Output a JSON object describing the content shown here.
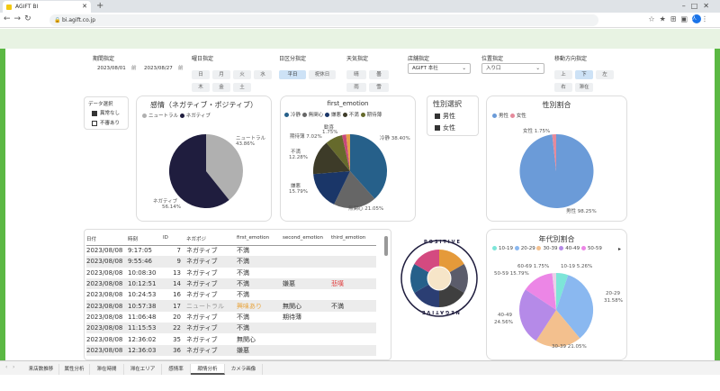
{
  "browser": {
    "tab_title": "AGIFT BI",
    "url": "bi.agift.co.jp"
  },
  "filters": {
    "period": {
      "label": "期間指定",
      "from": "2023/08/01",
      "sep": "前",
      "to": "2023/08/27",
      "sep2": "前"
    },
    "weekday": {
      "label": "曜日指定",
      "items": [
        "日",
        "月",
        "火",
        "水",
        "木",
        "金",
        "土"
      ]
    },
    "daytype": {
      "label": "日区分指定",
      "items": [
        "平日",
        "祝休日"
      ],
      "selected": "平日"
    },
    "weather": {
      "label": "天気指定",
      "items": [
        "晴",
        "曇",
        "雨",
        "雪"
      ]
    },
    "store": {
      "label": "店舗指定",
      "value": "AGIFT 本社"
    },
    "position": {
      "label": "位置指定",
      "value": "入り口"
    },
    "direction": {
      "label": "移動方向指定",
      "items": [
        "上",
        "下",
        "左",
        "右",
        "滞在"
      ],
      "selected": "下"
    }
  },
  "data_select": {
    "title": "データ選択",
    "items": [
      {
        "label": "異常なし",
        "checked": true
      },
      {
        "label": "不審あり",
        "checked": false
      }
    ]
  },
  "emotion_card": {
    "title": "感情（ネガティブ・ポジティブ）",
    "legend": [
      "ニュートラル",
      "ネガティブ"
    ],
    "labels": {
      "neutral": "ニュートラル",
      "neutral_pct": "43.86%",
      "negative": "ネガティブ",
      "negative_pct": "56.14%"
    }
  },
  "first_emotion_card": {
    "title": "first_emotion",
    "legend": [
      "冷静",
      "無関心",
      "嫌悪",
      "不満",
      "期待薄"
    ],
    "labels": {
      "calm": "冷静 38.40%",
      "indifferent": "無関心 21.05%",
      "disgust": "嫌悪",
      "disgust_pct": "15.79%",
      "dissatisfied": "不満",
      "dissatisfied_pct": "12.28%",
      "low_expect": "期待薄 7.02%",
      "delight": "歓喜",
      "delight_pct": "1.75%"
    }
  },
  "gender_select": {
    "title": "性別選択",
    "items": [
      {
        "label": "男性",
        "checked": true
      },
      {
        "label": "女性",
        "checked": true
      }
    ]
  },
  "gender_ratio": {
    "title": "性別割合",
    "legend": [
      "男性",
      "女性"
    ],
    "labels": {
      "female": "女性 1.75%",
      "male": "男性 98.25%"
    }
  },
  "table": {
    "columns": [
      "日付",
      "時刻",
      "ID",
      "ネガポジ",
      "first_emotion",
      "second_emotion",
      "third_emotion"
    ],
    "rows": [
      [
        "2023/08/08",
        "9:17:05",
        "7",
        "ネガティブ",
        "不満",
        "",
        ""
      ],
      [
        "2023/08/08",
        "9:55:46",
        "9",
        "ネガティブ",
        "不満",
        "",
        ""
      ],
      [
        "2023/08/08",
        "10:08:30",
        "13",
        "ネガティブ",
        "不満",
        "",
        ""
      ],
      [
        "2023/08/08",
        "10:12:51",
        "14",
        "ネガティブ",
        "不満",
        "嫌悪",
        "悲嘆"
      ],
      [
        "2023/08/08",
        "10:24:53",
        "16",
        "ネガティブ",
        "不満",
        "",
        ""
      ],
      [
        "2023/08/08",
        "10:57:38",
        "17",
        "ニュートラル",
        "興味あり",
        "無関心",
        "不満"
      ],
      [
        "2023/08/08",
        "11:06:48",
        "20",
        "ネガティブ",
        "不満",
        "期待薄",
        ""
      ],
      [
        "2023/08/08",
        "11:15:53",
        "22",
        "ネガティブ",
        "不満",
        "",
        ""
      ],
      [
        "2023/08/08",
        "12:36:02",
        "35",
        "ネガティブ",
        "無関心",
        "",
        ""
      ],
      [
        "2023/08/08",
        "12:36:03",
        "36",
        "ネガティブ",
        "嫌悪",
        "",
        ""
      ]
    ]
  },
  "wheel": {
    "top": "POSITIVE",
    "bottom": "NEGATIVE"
  },
  "age_ratio": {
    "title": "年代別割合",
    "legend": [
      "10-19",
      "20-29",
      "30-39",
      "40-49",
      "50-59"
    ],
    "labels": {
      "a60": "60-69 1.75%",
      "a10": "10-19 5.26%",
      "a5059": "50-59 15.79%",
      "a20": "20-29",
      "a20_pct": "31.58%",
      "a40": "40-49",
      "a40_pct": "24.56%",
      "a30": "30-39 21.05%"
    }
  },
  "bottom_tabs": [
    "来店数推移",
    "属性分析",
    "滞在時間",
    "滞在エリア",
    "感情率",
    "顔情分析",
    "カメラ画像"
  ],
  "active_tab": "顔情分析",
  "colors": {
    "green": "#5bb843",
    "navy": "#1f1d3e",
    "grey": "#b0b0b0",
    "male": "#6b9bd8",
    "female": "#e58a9b"
  }
}
